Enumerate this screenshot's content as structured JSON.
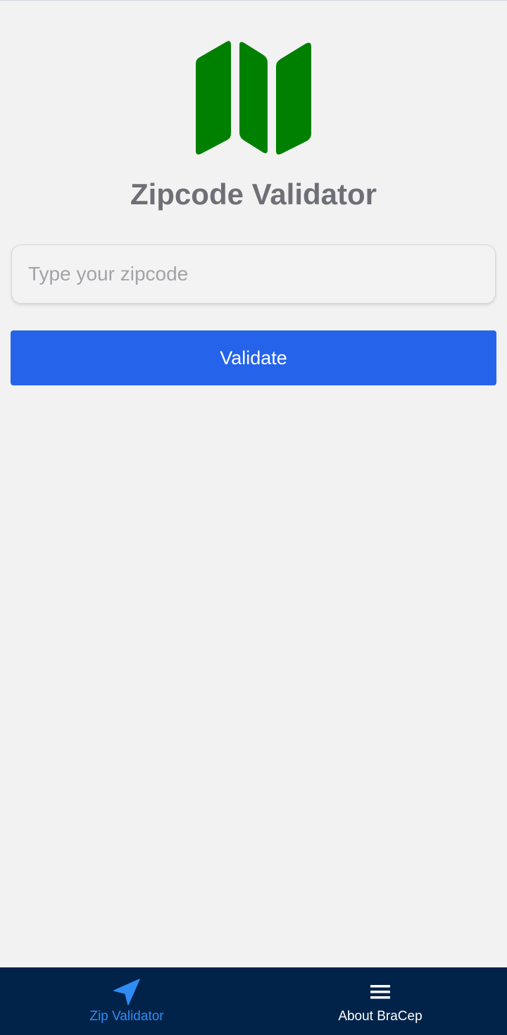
{
  "app": {
    "title": "Zipcode Validator",
    "logo_icon": "folded-map-icon",
    "logo_color": "#008000"
  },
  "form": {
    "zip_input": {
      "value": "",
      "placeholder": "Type your zipcode"
    },
    "validate_label": "Validate",
    "validate_color": "#2563eb"
  },
  "tab_bar": {
    "background": "#012349",
    "tabs": [
      {
        "label": "Zip Validator",
        "icon": "navigation-arrow-icon",
        "active": true,
        "color": "#2f8cf3"
      },
      {
        "label": "About BraCep",
        "icon": "menu-icon",
        "active": false,
        "color": "#ffffff"
      }
    ]
  }
}
